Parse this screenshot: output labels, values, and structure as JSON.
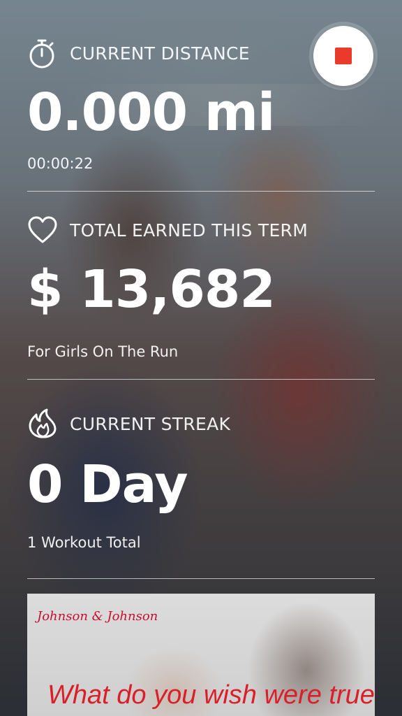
{
  "distance": {
    "label": "CURRENT DISTANCE",
    "value": "0.000 mi",
    "elapsed": "00:00:22",
    "icon": "stopwatch-icon"
  },
  "earnings": {
    "label": "TOTAL EARNED THIS TERM",
    "value": "$ 13,682",
    "cause": "For Girls On The Run",
    "icon": "heart-icon"
  },
  "streak": {
    "label": "CURRENT STREAK",
    "value": "0 Day",
    "workouts": "1 Workout Total",
    "icon": "flame-icon"
  },
  "controls": {
    "stop_icon": "stop-icon",
    "stop_color": "#ea3a2c"
  },
  "ad": {
    "brand": "Johnson & Johnson",
    "tagline": "What do you wish were true",
    "accent": "#d8202a"
  }
}
